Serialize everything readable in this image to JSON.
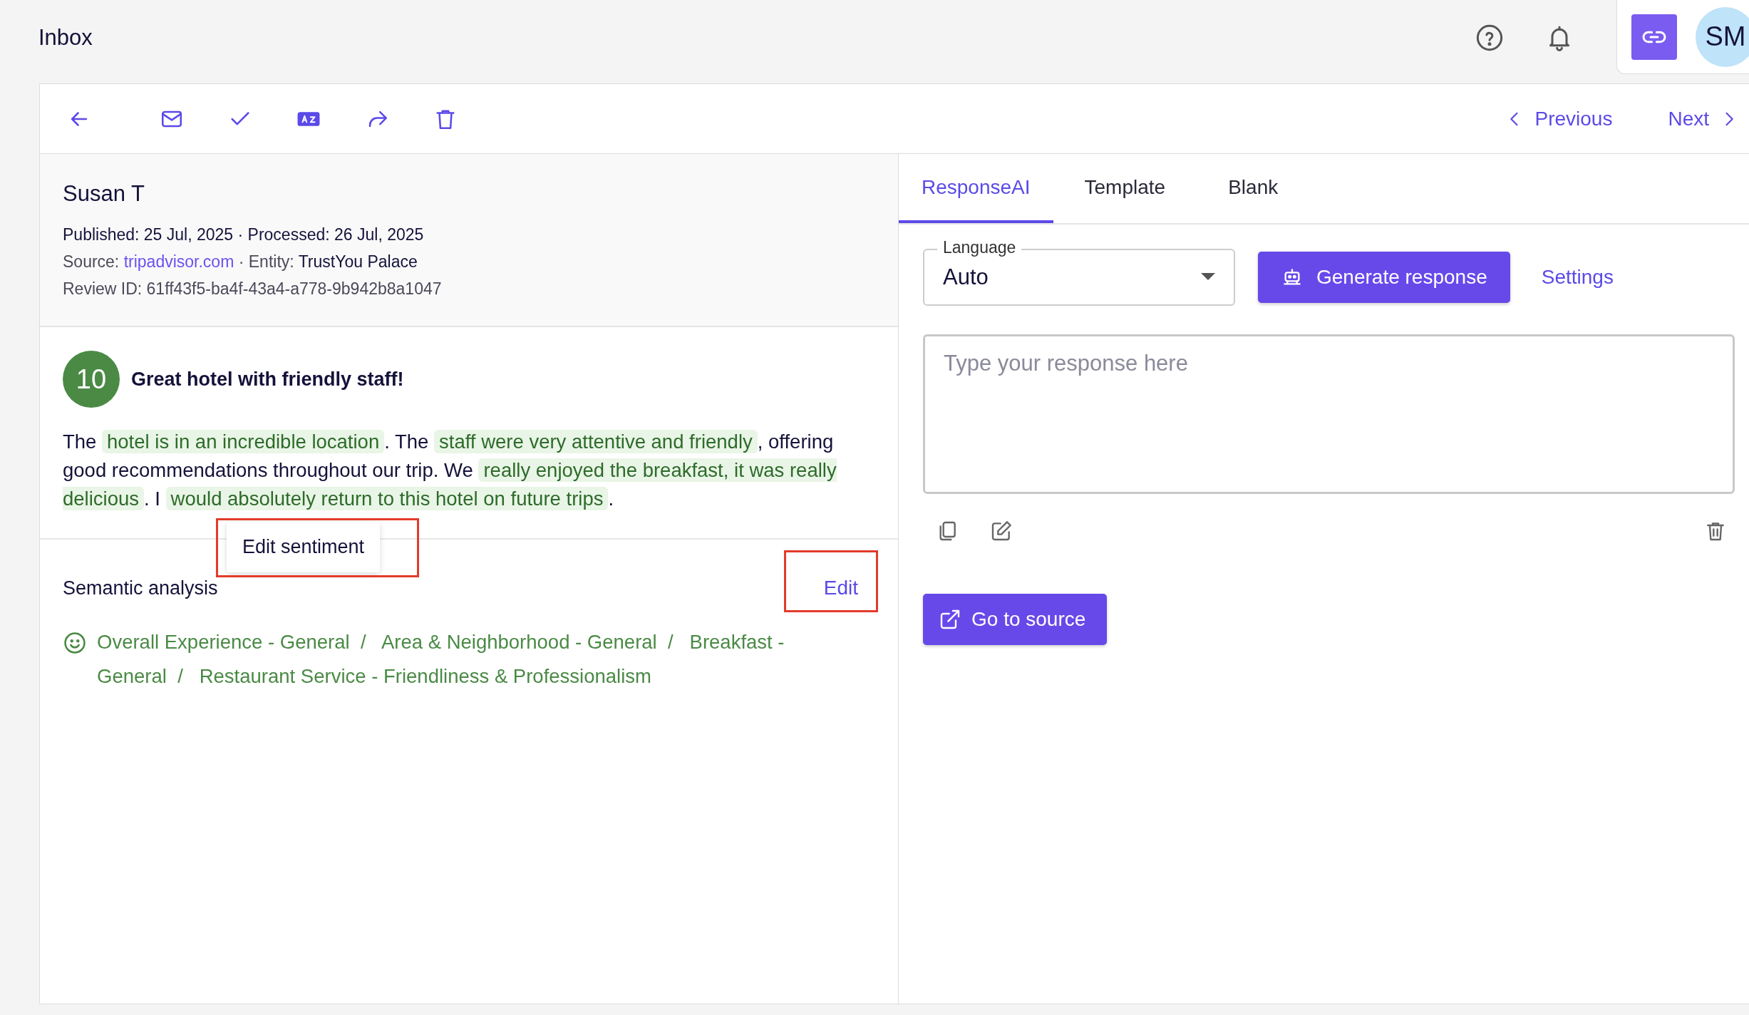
{
  "header": {
    "title": "Inbox",
    "avatar": "SM"
  },
  "toolbar": {
    "previous": "Previous",
    "next": "Next"
  },
  "review": {
    "author": "Susan T",
    "meta": [
      [
        {
          "text": "Published: 25 Jul, 2025 · Processed: 26 Jul, 2025",
          "kind": "dark"
        }
      ],
      [
        {
          "text": "Source: ",
          "kind": "muted"
        },
        {
          "text": "tripadvisor.com",
          "kind": "link"
        },
        {
          "text": " · Entity: ",
          "kind": "muted"
        },
        {
          "text": "TrustYou Palace",
          "kind": "dark"
        }
      ],
      [
        {
          "text": "Review ID: 61ff43f5-ba4f-43a4-a778-9b942b8a1047",
          "kind": "muted"
        }
      ]
    ],
    "score": "10",
    "title": "Great hotel with friendly staff!",
    "body": [
      {
        "text": "The ",
        "highlighted": false
      },
      {
        "text": "hotel is in an incredible location",
        "highlighted": true
      },
      {
        "text": ". The ",
        "highlighted": false
      },
      {
        "text": "staff were very attentive and friendly",
        "highlighted": true
      },
      {
        "text": ", offering good recommendations throughout our trip. We ",
        "highlighted": false
      },
      {
        "text": "really enjoyed the breakfast, it was really delicious",
        "highlighted": true
      },
      {
        "text": ". I ",
        "highlighted": false
      },
      {
        "text": "would absolutely return to this hotel on future trips",
        "highlighted": true
      },
      {
        "text": ".",
        "highlighted": false
      }
    ]
  },
  "tooltip": "Edit sentiment",
  "semantic": {
    "title": "Semantic analysis",
    "edit": "Edit",
    "separator": "/",
    "topics": [
      "Overall Experience - General",
      "Area & Neighborhood - General",
      "Breakfast - General",
      "Restaurant Service - Friendliness & Professionalism"
    ]
  },
  "tabs": [
    {
      "label": "ResponseAI",
      "selected": true
    },
    {
      "label": "Template",
      "selected": false
    },
    {
      "label": "Blank",
      "selected": false
    }
  ],
  "language": {
    "label": "Language",
    "value": "Auto"
  },
  "generate": "Generate response",
  "settings": "Settings",
  "response": {
    "placeholder": "Type your response here"
  },
  "go_to_source": "Go to source"
}
